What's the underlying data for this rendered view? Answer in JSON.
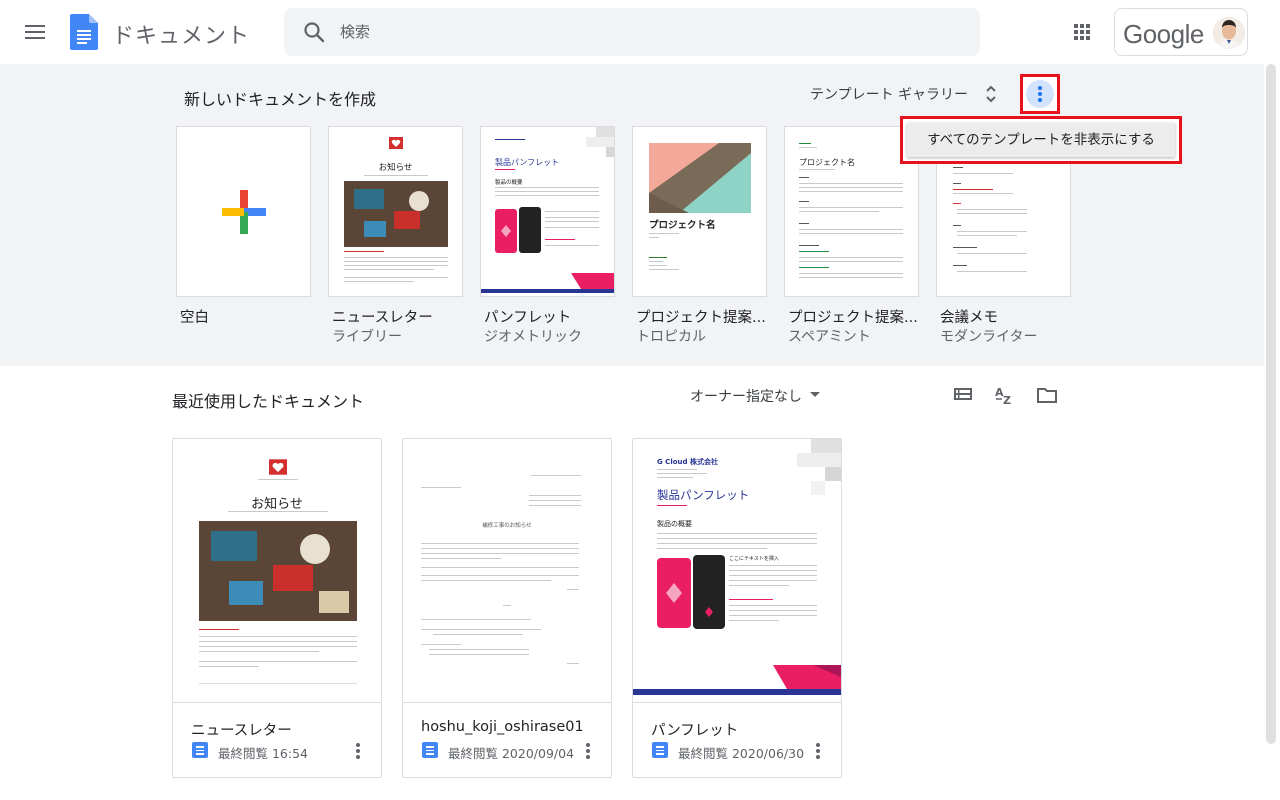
{
  "header": {
    "app_title": "ドキュメント",
    "search_placeholder": "検索",
    "account_brand": "Google"
  },
  "template_panel": {
    "title": "新しいドキュメントを作成",
    "gallery_label": "テンプレート ギャラリー",
    "menu_item": "すべてのテンプレートを非表示にする",
    "highlight_color": "#e8121c",
    "templates": [
      {
        "name": "空白",
        "sub": ""
      },
      {
        "name": "ニュースレター",
        "sub": "ライブリー",
        "thumb_title": "お知らせ"
      },
      {
        "name": "パンフレット",
        "sub": "ジオメトリック",
        "thumb_title": "製品パンフレット",
        "thumb_heading": "製品の概要"
      },
      {
        "name": "プロジェクト提案...",
        "sub": "トロピカル",
        "thumb_title": "プロジェクト名"
      },
      {
        "name": "プロジェクト提案...",
        "sub": "スペアミント",
        "thumb_title": "プロジェクト名"
      },
      {
        "name": "会議メモ",
        "sub": "モダンライター"
      }
    ]
  },
  "recent": {
    "title": "最近使用したドキュメント",
    "owner_filter": "オーナー指定なし",
    "docs": [
      {
        "name": "ニュースレター",
        "meta": "最終閲覧 16:54",
        "thumb_title": "お知らせ"
      },
      {
        "name": "hoshu_koji_oshirase01",
        "meta": "最終閲覧 2020/09/04",
        "thumb_title": "補修工事のお知らせ"
      },
      {
        "name": "パンフレット",
        "meta": "最終閲覧 2020/06/30",
        "thumb_company": "G Cloud 株式会社",
        "thumb_title": "製品パンフレット",
        "thumb_heading": "製品の概要",
        "thumb_sub": "ここにテキストを挿入"
      }
    ]
  },
  "colors": {
    "panel_bg": "#f1f3f4",
    "docs_blue": "#4285f4",
    "selected_blue": "#1a73e8"
  }
}
